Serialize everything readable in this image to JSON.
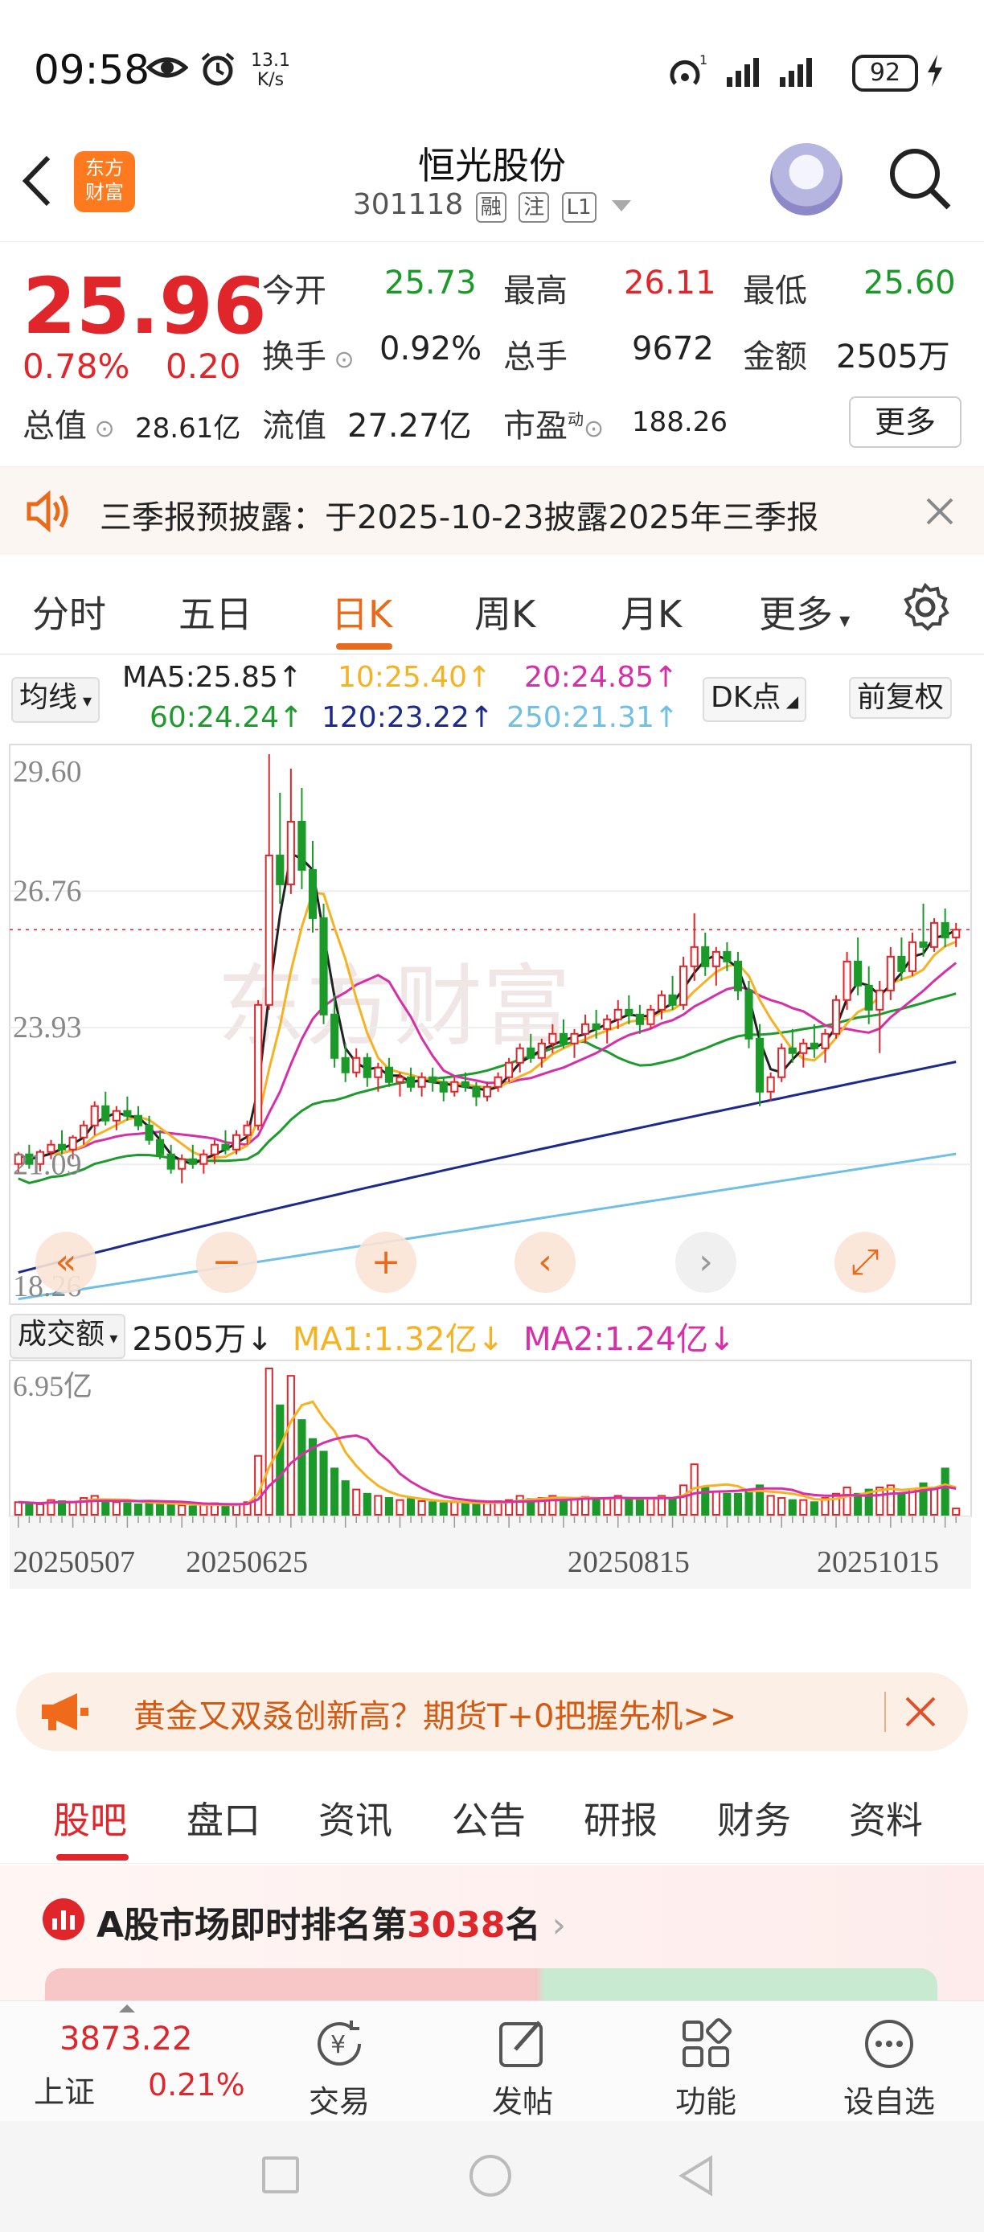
{
  "status_bar": {
    "time": "09:58",
    "net_speed_value": "13.1",
    "net_speed_unit": "K/s",
    "battery": "92"
  },
  "header": {
    "logo_text_1": "东方",
    "logo_text_2": "财富",
    "title": "恒光股份",
    "code": "301118",
    "tags": [
      "融",
      "注",
      "L1"
    ]
  },
  "quote": {
    "price": "25.96",
    "change_pct": "0.78%",
    "change_amt": "0.20",
    "open_label": "今开",
    "open": "25.73",
    "high_label": "最高",
    "high": "26.11",
    "low_label": "最低",
    "low": "25.60",
    "turnover_label": "换手",
    "turnover": "0.92%",
    "volume_label": "总手",
    "volume": "9672",
    "amount_label": "金额",
    "amount": "2505万",
    "total_value_label": "总值",
    "total_value": "28.61亿",
    "float_value_label": "流值",
    "float_value": "27.27亿",
    "pe_label": "市盈",
    "pe_sup": "动",
    "pe": "188.26",
    "more": "更多"
  },
  "notice": {
    "text": "三季报预披露：于2025-10-23披露2025年三季报"
  },
  "period_tabs": [
    "分时",
    "五日",
    "日K",
    "周K",
    "月K",
    "更多"
  ],
  "active_period": "日K",
  "ma_legend": {
    "selector": "均线",
    "ma5": "MA5:25.85",
    "ma10": "10:25.40",
    "ma20": "20:24.85",
    "ma60": "60:24.24",
    "ma120": "120:23.22",
    "ma250": "250:21.31",
    "dk_button": "DK点",
    "adjust_button": "前复权"
  },
  "colors": {
    "up": "#e0262b",
    "down": "#1b9a2a",
    "ma5": "#222222",
    "ma10": "#f5b223",
    "ma20": "#d62fa8",
    "ma60": "#1f9a2e",
    "ma120": "#1c2a8c",
    "ma250": "#6fbfe6",
    "accent": "#e86b1b"
  },
  "chart_data": {
    "type": "candlestick",
    "y_ticks": [
      "29.60",
      "26.76",
      "23.93",
      "21.09",
      "18.26"
    ],
    "ylim": [
      18.26,
      29.6
    ],
    "x_labels": [
      "20250507",
      "20250625",
      "20250815",
      "20251015"
    ],
    "last_price_line": 25.96,
    "controls": [
      "fast-back",
      "zoom-out",
      "zoom-in",
      "step-left",
      "step-right",
      "fullscreen"
    ],
    "volume_panel": {
      "selector": "成交额",
      "value": "2505万",
      "ma1": "MA1:1.32亿",
      "ma2": "MA2:1.24亿",
      "max_label": "6.95亿",
      "ylim": [
        0,
        6.95
      ]
    },
    "candles": [
      [
        21.1,
        21.35,
        20.9,
        21.3
      ],
      [
        21.3,
        21.5,
        21.0,
        21.1
      ],
      [
        21.1,
        21.4,
        20.95,
        21.35
      ],
      [
        21.35,
        21.6,
        21.2,
        21.5
      ],
      [
        21.5,
        21.8,
        21.3,
        21.4
      ],
      [
        21.4,
        21.7,
        21.2,
        21.65
      ],
      [
        21.65,
        22.0,
        21.5,
        21.9
      ],
      [
        21.9,
        22.4,
        21.7,
        22.3
      ],
      [
        22.3,
        22.6,
        21.9,
        22.0
      ],
      [
        22.0,
        22.3,
        21.8,
        22.2
      ],
      [
        22.2,
        22.5,
        22.0,
        22.1
      ],
      [
        22.1,
        22.3,
        21.8,
        21.9
      ],
      [
        21.9,
        22.1,
        21.5,
        21.6
      ],
      [
        21.6,
        21.8,
        21.2,
        21.3
      ],
      [
        21.3,
        21.5,
        20.9,
        21.0
      ],
      [
        21.0,
        21.3,
        20.7,
        21.2
      ],
      [
        21.2,
        21.5,
        21.0,
        21.1
      ],
      [
        21.1,
        21.4,
        20.9,
        21.3
      ],
      [
        21.3,
        21.6,
        21.1,
        21.5
      ],
      [
        21.5,
        21.8,
        21.3,
        21.4
      ],
      [
        21.4,
        21.8,
        21.3,
        21.7
      ],
      [
        21.7,
        22.0,
        21.5,
        21.9
      ],
      [
        21.9,
        24.5,
        21.8,
        24.4
      ],
      [
        24.4,
        29.6,
        24.3,
        27.5
      ],
      [
        27.5,
        28.8,
        26.5,
        26.9
      ],
      [
        26.9,
        29.3,
        26.7,
        28.2
      ],
      [
        28.2,
        28.9,
        26.8,
        27.2
      ],
      [
        27.2,
        27.8,
        25.9,
        26.2
      ],
      [
        26.2,
        26.5,
        24.0,
        24.2
      ],
      [
        24.2,
        24.6,
        23.1,
        23.3
      ],
      [
        23.3,
        23.6,
        22.8,
        23.0
      ],
      [
        23.0,
        23.5,
        22.9,
        23.3
      ],
      [
        23.3,
        23.4,
        22.7,
        22.9
      ],
      [
        22.9,
        23.2,
        22.6,
        23.1
      ],
      [
        23.1,
        23.3,
        22.7,
        22.8
      ],
      [
        22.8,
        23.0,
        22.5,
        22.9
      ],
      [
        22.9,
        23.1,
        22.6,
        22.7
      ],
      [
        22.7,
        23.0,
        22.5,
        22.9
      ],
      [
        22.9,
        23.1,
        22.6,
        22.8
      ],
      [
        22.8,
        22.9,
        22.4,
        22.6
      ],
      [
        22.6,
        22.9,
        22.5,
        22.8
      ],
      [
        22.8,
        23.0,
        22.6,
        22.7
      ],
      [
        22.7,
        22.8,
        22.3,
        22.5
      ],
      [
        22.5,
        22.8,
        22.4,
        22.7
      ],
      [
        22.7,
        23.0,
        22.6,
        22.9
      ],
      [
        22.9,
        23.3,
        22.8,
        23.2
      ],
      [
        23.2,
        23.6,
        23.0,
        23.5
      ],
      [
        23.5,
        23.8,
        23.2,
        23.3
      ],
      [
        23.3,
        23.7,
        23.1,
        23.6
      ],
      [
        23.6,
        24.0,
        23.4,
        23.8
      ],
      [
        23.8,
        24.1,
        23.5,
        23.6
      ],
      [
        23.6,
        23.9,
        23.3,
        23.8
      ],
      [
        23.8,
        24.2,
        23.6,
        24.0
      ],
      [
        24.0,
        24.3,
        23.7,
        23.9
      ],
      [
        23.9,
        24.2,
        23.6,
        24.1
      ],
      [
        24.1,
        24.5,
        23.9,
        24.3
      ],
      [
        24.3,
        24.6,
        24.0,
        24.2
      ],
      [
        24.2,
        24.4,
        23.8,
        24.0
      ],
      [
        24.0,
        24.4,
        23.9,
        24.3
      ],
      [
        24.3,
        24.7,
        24.1,
        24.6
      ],
      [
        24.6,
        25.0,
        24.3,
        24.4
      ],
      [
        24.4,
        25.4,
        24.3,
        25.2
      ],
      [
        25.2,
        26.3,
        24.9,
        25.6
      ],
      [
        25.6,
        25.9,
        25.0,
        25.2
      ],
      [
        25.2,
        25.6,
        24.8,
        25.5
      ],
      [
        25.5,
        25.7,
        25.1,
        25.3
      ],
      [
        25.3,
        25.5,
        24.5,
        24.7
      ],
      [
        24.7,
        24.9,
        23.5,
        23.7
      ],
      [
        23.7,
        24.0,
        22.3,
        22.6
      ],
      [
        22.6,
        23.0,
        22.4,
        22.9
      ],
      [
        22.9,
        23.6,
        22.8,
        23.5
      ],
      [
        23.5,
        23.9,
        23.2,
        23.4
      ],
      [
        23.4,
        23.7,
        23.1,
        23.6
      ],
      [
        23.6,
        24.0,
        23.3,
        23.5
      ],
      [
        23.5,
        23.9,
        23.2,
        23.8
      ],
      [
        23.8,
        24.6,
        23.7,
        24.5
      ],
      [
        24.5,
        25.5,
        24.3,
        25.3
      ],
      [
        25.3,
        25.8,
        24.6,
        24.8
      ],
      [
        24.8,
        25.2,
        24.0,
        24.3
      ],
      [
        24.3,
        24.9,
        23.4,
        24.7
      ],
      [
        24.7,
        25.6,
        24.5,
        25.4
      ],
      [
        25.4,
        25.8,
        24.9,
        25.1
      ],
      [
        25.1,
        25.9,
        25.0,
        25.7
      ],
      [
        25.7,
        26.5,
        25.4,
        25.6
      ],
      [
        25.6,
        26.2,
        25.5,
        26.1
      ],
      [
        26.1,
        26.4,
        25.6,
        25.8
      ],
      [
        25.8,
        26.1,
        25.6,
        25.96
      ]
    ],
    "volume": [
      0.6,
      0.55,
      0.5,
      0.7,
      0.65,
      0.6,
      0.8,
      0.9,
      0.7,
      0.6,
      0.55,
      0.5,
      0.6,
      0.55,
      0.5,
      0.45,
      0.4,
      0.5,
      0.55,
      0.45,
      0.5,
      0.6,
      2.8,
      6.95,
      5.2,
      6.6,
      4.5,
      3.6,
      3.0,
      2.2,
      1.6,
      1.2,
      1.0,
      0.9,
      0.8,
      0.7,
      0.75,
      0.65,
      0.6,
      0.55,
      0.6,
      0.55,
      0.5,
      0.6,
      0.65,
      0.7,
      0.9,
      0.75,
      0.8,
      0.9,
      0.7,
      0.8,
      0.85,
      0.7,
      0.8,
      0.9,
      0.75,
      0.7,
      0.8,
      0.9,
      0.8,
      1.4,
      2.4,
      1.3,
      1.1,
      1.0,
      1.0,
      1.2,
      1.4,
      0.9,
      0.8,
      0.7,
      0.7,
      0.6,
      0.8,
      1.0,
      1.3,
      1.0,
      1.2,
      1.3,
      1.4,
      1.0,
      1.2,
      1.5,
      1.3,
      2.2,
      0.3
    ]
  },
  "banner": {
    "text": "黄金又双叒创新高？期货T+0把握先机>>"
  },
  "content_tabs": [
    "股吧",
    "盘口",
    "资讯",
    "公告",
    "研报",
    "财务",
    "资料"
  ],
  "active_content_tab": "股吧",
  "rank": {
    "prefix": "A股市场即时排名第",
    "number": "3038",
    "suffix": "名"
  },
  "bottom_nav": {
    "index_value": "3873.22",
    "index_name": "上证",
    "index_change": "0.21%",
    "items": [
      "交易",
      "发帖",
      "功能",
      "设自选"
    ]
  }
}
